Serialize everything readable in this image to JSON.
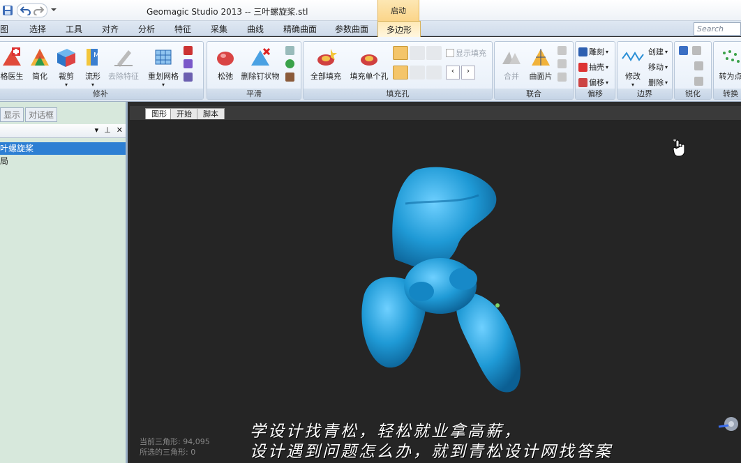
{
  "app": {
    "title": "Geomagic Studio 2013 -- 三叶螺旋桨.stl",
    "context_tab_header": "启动",
    "search_placeholder": "Search"
  },
  "tabs": [
    {
      "label": "图"
    },
    {
      "label": "选择"
    },
    {
      "label": "工具"
    },
    {
      "label": "对齐"
    },
    {
      "label": "分析"
    },
    {
      "label": "特征"
    },
    {
      "label": "采集"
    },
    {
      "label": "曲线"
    },
    {
      "label": "精确曲面"
    },
    {
      "label": "参数曲面"
    },
    {
      "label": "多边形"
    }
  ],
  "ribbon": {
    "repair": {
      "label": "修补",
      "buttons": [
        "格医生",
        "简化",
        "裁剪",
        "流形",
        "去除特征",
        "重划网格"
      ]
    },
    "smooth": {
      "label": "平滑",
      "buttons": [
        "松弛",
        "删除钉状物"
      ]
    },
    "fill": {
      "label": "填充孔",
      "buttons": [
        "全部填充",
        "填充单个孔"
      ],
      "show_fill": "显示填充"
    },
    "union": {
      "label": "联合",
      "buttons": [
        "合并",
        "曲面片"
      ]
    },
    "offset": {
      "label": "偏移",
      "items": [
        "雕刻",
        "抽壳",
        "偏移"
      ]
    },
    "boundary": {
      "label": "边界",
      "modify": "修改",
      "items": [
        "创建",
        "移动",
        "删除"
      ]
    },
    "sharpen": {
      "label": "锐化"
    },
    "convert": {
      "label": "转换",
      "button": "转为点"
    }
  },
  "left_panel": {
    "tabs": [
      "显示",
      "对话框"
    ],
    "tree": [
      {
        "label": "叶螺旋桨"
      },
      {
        "label": "局"
      }
    ]
  },
  "viewport": {
    "tabs": [
      "图形",
      "开始",
      "脚本"
    ],
    "stats": {
      "current_triangles": "当前三角形: 94,095",
      "selected_triangles": "所选的三角形: 0"
    },
    "subtitle_line1": "学设计找青松，轻松就业拿高薪，",
    "subtitle_line2": "设计遇到问题怎么办，就到青松设计网找答案"
  },
  "colors": {
    "propeller": "#1f9ad6",
    "viewport_bg": "#252525",
    "panel_bg": "#d7e8dc",
    "selected": "#2d7fd3"
  }
}
